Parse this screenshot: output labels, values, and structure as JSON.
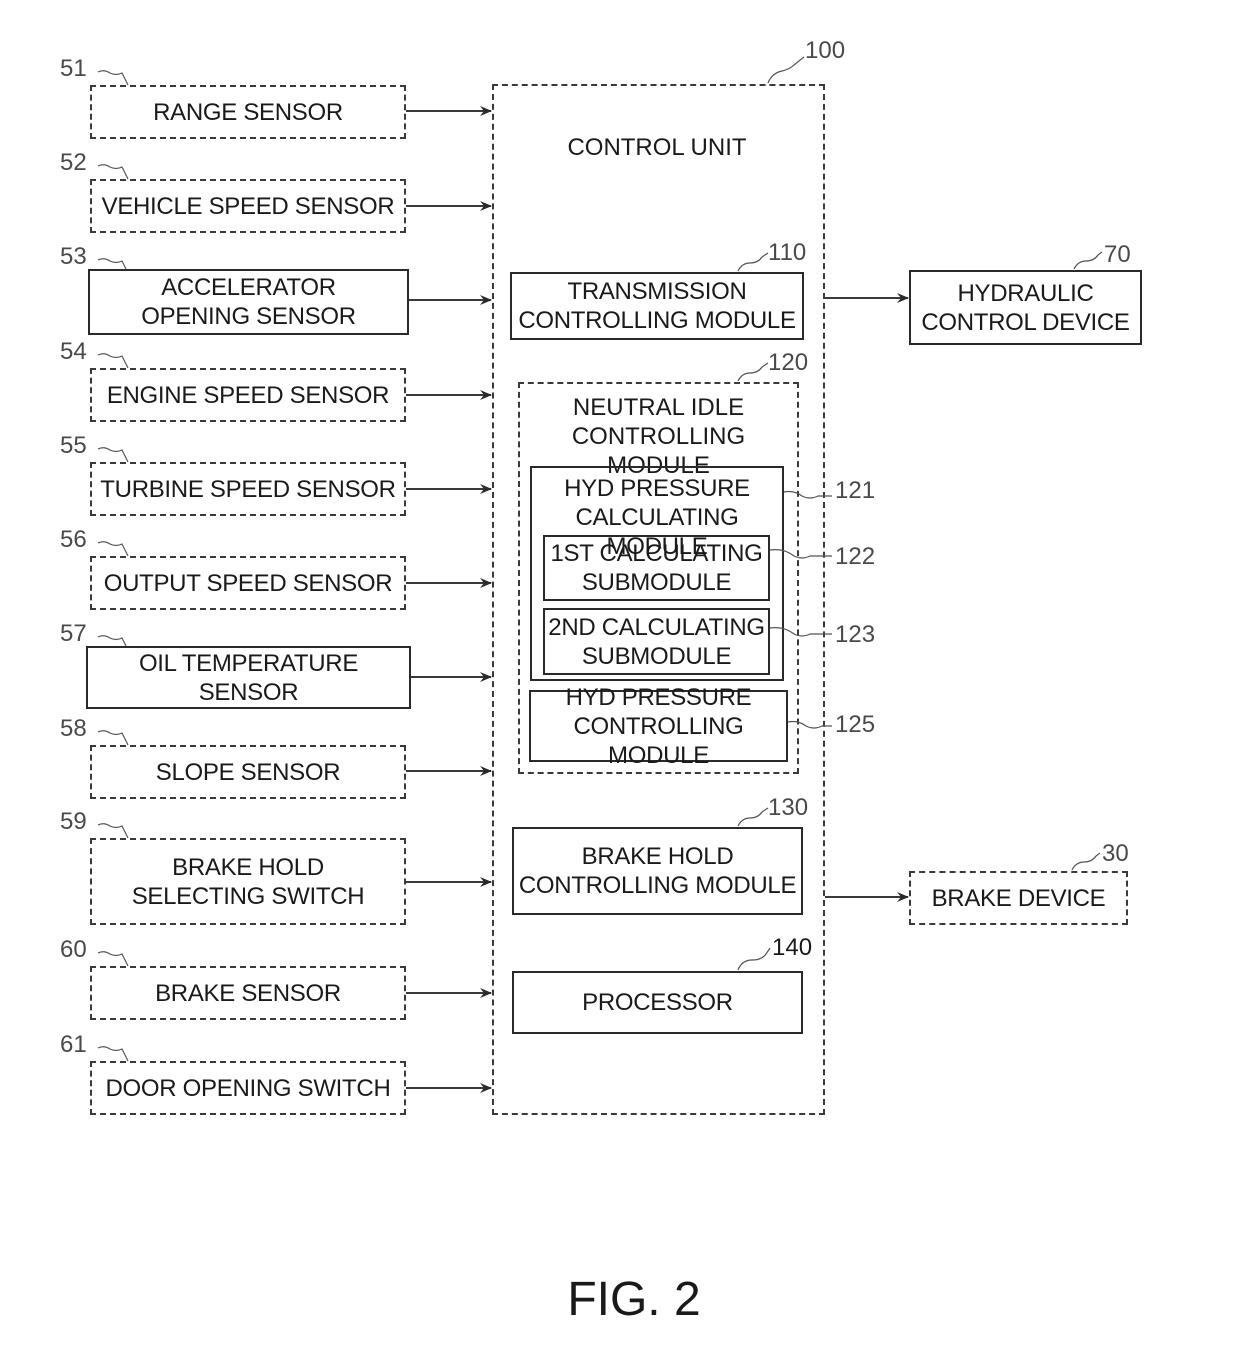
{
  "figure_label": "FIG. 2",
  "sensors": [
    {
      "ref": "51",
      "label": "RANGE SENSOR"
    },
    {
      "ref": "52",
      "label": "VEHICLE SPEED SENSOR"
    },
    {
      "ref": "53",
      "label": "ACCELERATOR\nOPENING SENSOR"
    },
    {
      "ref": "54",
      "label": "ENGINE SPEED SENSOR"
    },
    {
      "ref": "55",
      "label": "TURBINE SPEED SENSOR"
    },
    {
      "ref": "56",
      "label": "OUTPUT SPEED SENSOR"
    },
    {
      "ref": "57",
      "label": "OIL TEMPERATURE SENSOR"
    },
    {
      "ref": "58",
      "label": "SLOPE SENSOR"
    },
    {
      "ref": "59",
      "label": "BRAKE HOLD\nSELECTING SWITCH"
    },
    {
      "ref": "60",
      "label": "BRAKE SENSOR"
    },
    {
      "ref": "61",
      "label": "DOOR OPENING SWITCH"
    }
  ],
  "control_unit": {
    "ref": "100",
    "label": "CONTROL UNIT",
    "transmission_module": {
      "ref": "110",
      "label": "TRANSMISSION\nCONTROLLING MODULE"
    },
    "neutral_idle_module": {
      "ref": "120",
      "label": "NEUTRAL IDLE\nCONTROLLING MODULE",
      "hyd_calc_module": {
        "ref": "121",
        "label": "HYD PRESSURE\nCALCULATING MODULE"
      },
      "first_submodule": {
        "ref": "122",
        "label": "1ST CALCULATING\nSUBMODULE"
      },
      "second_submodule": {
        "ref": "123",
        "label": "2ND CALCULATING\nSUBMODULE"
      },
      "hyd_ctrl_module": {
        "ref": "125",
        "label": "HYD PRESSURE\nCONTROLLING MODULE"
      }
    },
    "brake_hold_module": {
      "ref": "130",
      "label": "BRAKE HOLD\nCONTROLLING MODULE"
    },
    "processor": {
      "ref": "140",
      "label": "PROCESSOR"
    }
  },
  "outputs": {
    "hydraulic": {
      "ref": "70",
      "label": "HYDRAULIC\nCONTROL DEVICE"
    },
    "brake": {
      "ref": "30",
      "label": "BRAKE DEVICE"
    }
  }
}
